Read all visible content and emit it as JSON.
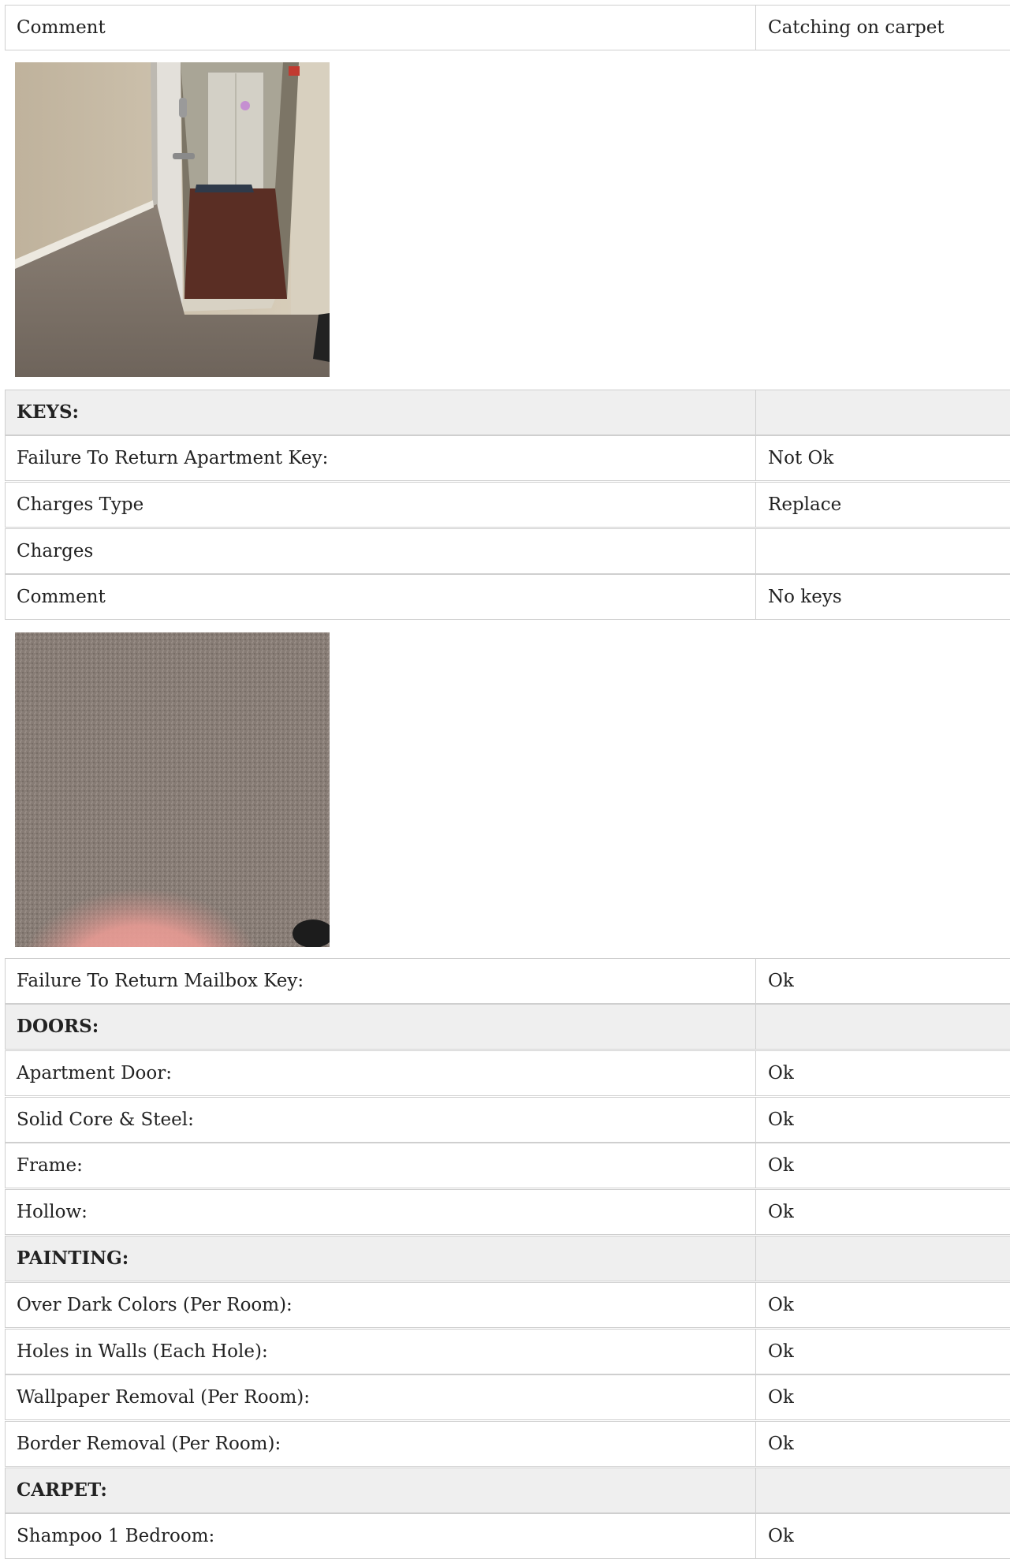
{
  "rows": {
    "r0": {
      "label": "Comment",
      "value": "Catching on carpet"
    },
    "r1": {
      "label": "KEYS:",
      "value": ""
    },
    "r2": {
      "label": "Failure To Return Apartment Key:",
      "value": "Not Ok"
    },
    "r3": {
      "label": "Charges Type",
      "value": "Replace"
    },
    "r4": {
      "label": "Charges",
      "value": ""
    },
    "r5": {
      "label": "Comment",
      "value": "No keys"
    },
    "r6": {
      "label": "Failure To Return Mailbox Key:",
      "value": "Ok"
    },
    "r7": {
      "label": "DOORS:",
      "value": ""
    },
    "r8": {
      "label": "Apartment Door:",
      "value": "Ok"
    },
    "r9": {
      "label": "Solid Core & Steel:",
      "value": "Ok"
    },
    "r10": {
      "label": "Frame:",
      "value": "Ok"
    },
    "r11": {
      "label": "Hollow:",
      "value": "Ok"
    },
    "r12": {
      "label": "PAINTING:",
      "value": ""
    },
    "r13": {
      "label": "Over Dark Colors (Per Room):",
      "value": "Ok"
    },
    "r14": {
      "label": "Holes in Walls (Each Hole):",
      "value": "Ok"
    },
    "r15": {
      "label": "Wallpaper Removal (Per Room):",
      "value": "Ok"
    },
    "r16": {
      "label": "Border Removal (Per Room):",
      "value": "Ok"
    },
    "r17": {
      "label": "CARPET:",
      "value": ""
    },
    "r18": {
      "label": "Shampoo 1 Bedroom:",
      "value": "Ok"
    }
  },
  "colors": {
    "border": "#cfcfcf",
    "section_background": "#efefef",
    "text": "#222222"
  }
}
